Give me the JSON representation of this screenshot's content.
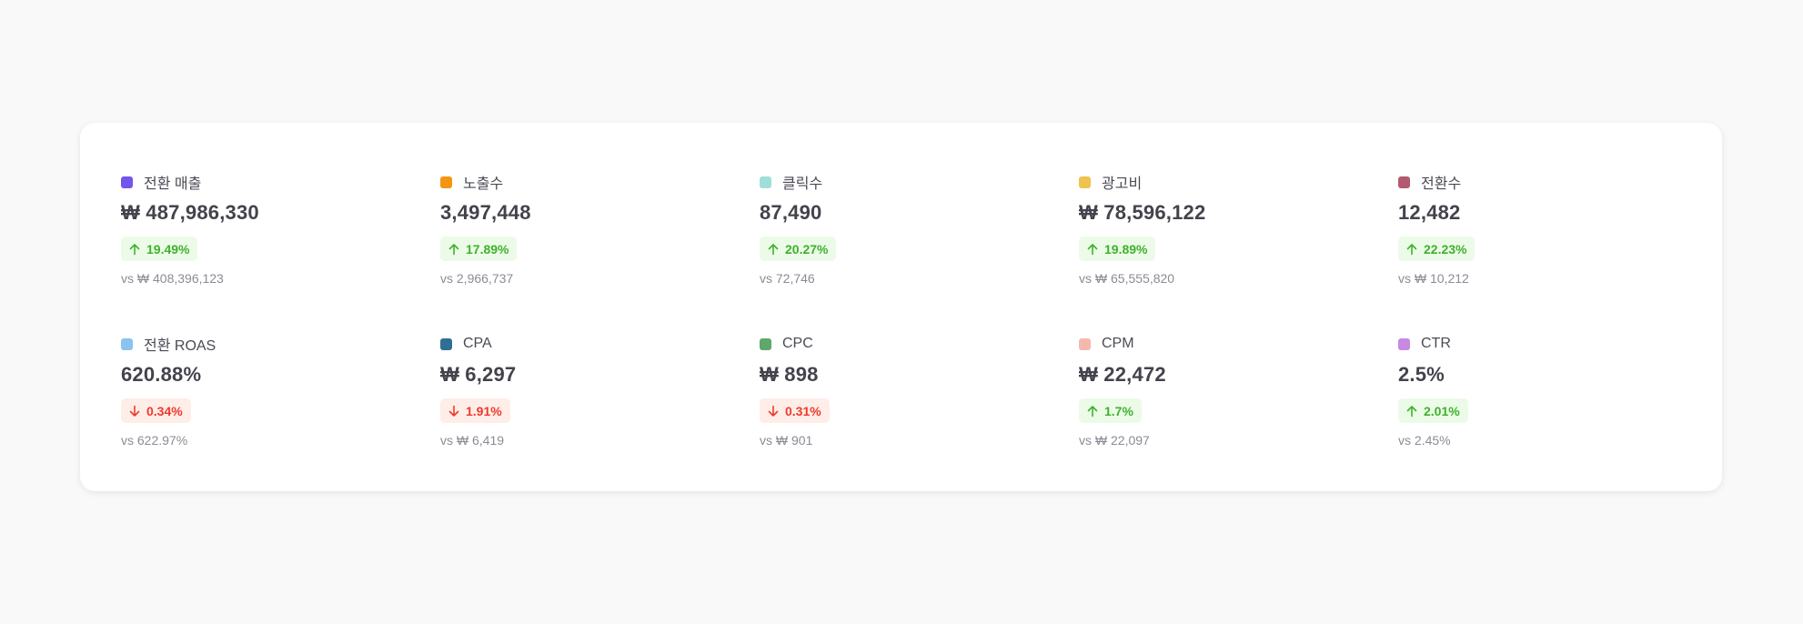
{
  "metrics": [
    {
      "label": "전환 매출",
      "value": "₩ 487,986,330",
      "change": "19.49%",
      "direction": "up",
      "compare": "vs ₩ 408,396,123",
      "color": "#7354ec"
    },
    {
      "label": "노출수",
      "value": "3,497,448",
      "change": "17.89%",
      "direction": "up",
      "compare": "vs 2,966,737",
      "color": "#f59512"
    },
    {
      "label": "클릭수",
      "value": "87,490",
      "change": "20.27%",
      "direction": "up",
      "compare": "vs 72,746",
      "color": "#9edfd9"
    },
    {
      "label": "광고비",
      "value": "₩ 78,596,122",
      "change": "19.89%",
      "direction": "up",
      "compare": "vs ₩ 65,555,820",
      "color": "#f0c24f"
    },
    {
      "label": "전환수",
      "value": "12,482",
      "change": "22.23%",
      "direction": "up",
      "compare": "vs ₩ 10,212",
      "color": "#b25a70"
    },
    {
      "label": "전환 ROAS",
      "value": "620.88%",
      "change": "0.34%",
      "direction": "down",
      "compare": "vs 622.97%",
      "color": "#8cc2ee"
    },
    {
      "label": "CPA",
      "value": "₩ 6,297",
      "change": "1.91%",
      "direction": "down",
      "compare": "vs ₩ 6,419",
      "color": "#2f6f95"
    },
    {
      "label": "CPC",
      "value": "₩ 898",
      "change": "0.31%",
      "direction": "down",
      "compare": "vs ₩ 901",
      "color": "#5ea86b"
    },
    {
      "label": "CPM",
      "value": "₩ 22,472",
      "change": "1.7%",
      "direction": "up",
      "compare": "vs ₩ 22,097",
      "color": "#f4b9ad"
    },
    {
      "label": "CTR",
      "value": "2.5%",
      "change": "2.01%",
      "direction": "up",
      "compare": "vs 2.45%",
      "color": "#c78ae0"
    }
  ]
}
